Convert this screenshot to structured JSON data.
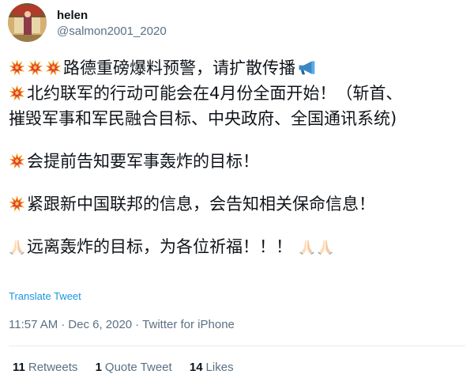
{
  "user": {
    "name": "helen",
    "handle": "@salmon2001_2020"
  },
  "tweet": {
    "line1": "路德重磅爆料预警，请扩散传播",
    "line2": "北约联军的行动可能会在4月份全面开始！（斩首、",
    "line3": "摧毁军事和军民融合目标、中央政府、全国通讯系统)",
    "line4": "会提前告知要军事轰炸的目标！",
    "line5": "紧跟新中国联邦的信息，会告知相关保命信息！",
    "line6": "远离轰炸的目标，为各位祈福！！！",
    "emoji_icons": [
      "collision-icon",
      "loudspeaker-icon",
      "folded-hands-icon"
    ]
  },
  "translate_label": "Translate Tweet",
  "meta": {
    "time": "11:57 AM",
    "separator": "·",
    "date": "Dec 6, 2020",
    "source": "Twitter for iPhone"
  },
  "stats": {
    "retweets": {
      "count": "11",
      "label": "Retweets"
    },
    "quotes": {
      "count": "1",
      "label": "Quote Tweet"
    },
    "likes": {
      "count": "14",
      "label": "Likes"
    }
  },
  "colors": {
    "link": "#1b95e0",
    "secondary_text": "#5b7083",
    "divider": "#e6ecf0"
  }
}
